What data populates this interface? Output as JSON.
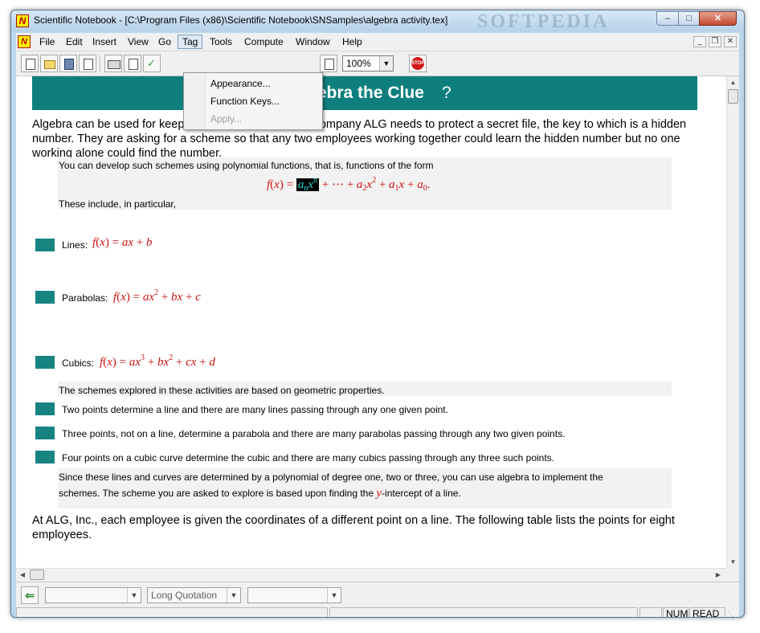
{
  "window": {
    "title": "Scientific Notebook - [C:\\Program Files (x86)\\Scientific Notebook\\SNSamples\\algebra activity.tex]",
    "watermark": "SOFTPEDIA"
  },
  "menu": {
    "items": [
      "File",
      "Edit",
      "Insert",
      "View",
      "Go",
      "Tag",
      "Tools",
      "Compute",
      "Window",
      "Help"
    ],
    "active": "Tag"
  },
  "tag_menu": {
    "items": [
      {
        "label": "Appearance...",
        "enabled": true
      },
      {
        "label": "Function Keys...",
        "enabled": true
      },
      {
        "label": "Apply...",
        "enabled": false
      }
    ]
  },
  "toolbar": {
    "zoom": "100%",
    "stop_label": "STOP"
  },
  "document": {
    "heading_visible": "gebra the Clue",
    "heading_qmark": "?",
    "intro": "Algebra can be used for keeping (and telling) secrets. Company ALG needs to protect a secret file, the key to which is a hidden number. They are asking for a scheme so that any two employees working together could learn the hidden number but no one working alone could find the number.",
    "schemes_line": "You can develop such schemes using polynomial functions, that is, functions of the form",
    "include_line": "These include, in particular,",
    "lines_label": "Lines:",
    "parabolas_label": "Parabolas:",
    "cubics_label": "Cubics:",
    "geom_line": "The schemes explored in these activities are based on geometric properties.",
    "bullet1": "Two points determine a line and there are many lines passing through any one given point.",
    "bullet2": "Three points, not on a line, determine a parabola and there are many parabolas passing through any two given points.",
    "bullet3": "Four points on a cubic curve determine the cubic and there are many cubics passing through any three such points.",
    "since_line1": "Since these lines and curves are determined by a polynomial of degree one, two or three, you can use algebra to implement the",
    "since_line2a": "schemes. The scheme you are asked to explore is based upon finding the ",
    "since_var": "y",
    "since_line2b": "-intercept of a line.",
    "closing": "At ALG, Inc., each employee is given the coordinates of a different point on a line. The following table lists the points for eight employees."
  },
  "bottombar": {
    "combo1": "",
    "combo2": "Long Quotation",
    "combo3": ""
  },
  "status": {
    "num": "NUM",
    "read": "READ"
  },
  "colors": {
    "heading_bg": "#0f7f7e",
    "bullet_box": "#178482",
    "math_red": "#cc1111",
    "band_gray": "#f2f2f2"
  }
}
